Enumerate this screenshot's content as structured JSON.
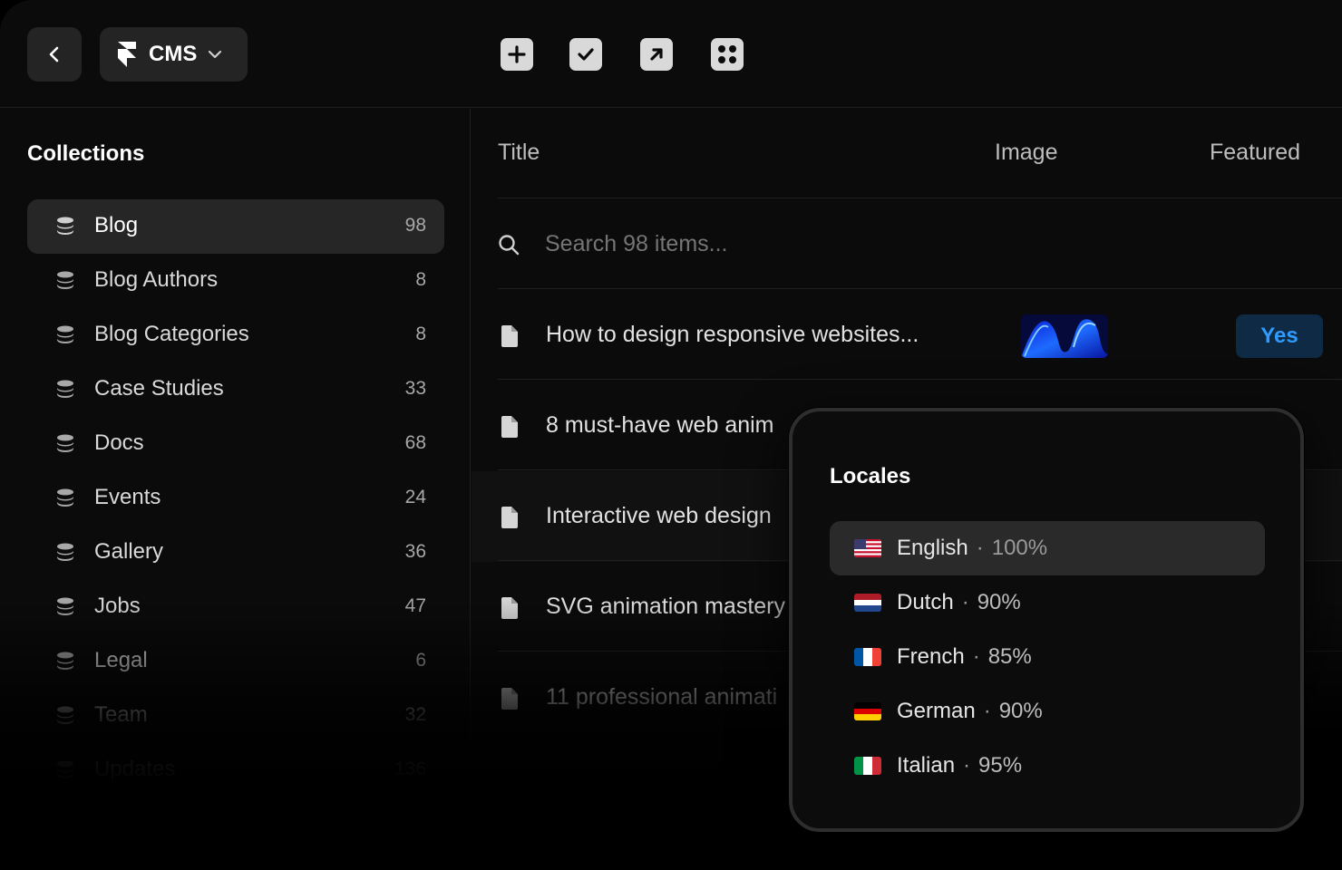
{
  "toolbar": {
    "cms_label": "CMS"
  },
  "sidebar": {
    "title": "Collections",
    "items": [
      {
        "label": "Blog",
        "count": "98",
        "active": true
      },
      {
        "label": "Blog Authors",
        "count": "8"
      },
      {
        "label": "Blog Categories",
        "count": "8"
      },
      {
        "label": "Case Studies",
        "count": "33"
      },
      {
        "label": "Docs",
        "count": "68"
      },
      {
        "label": "Events",
        "count": "24"
      },
      {
        "label": "Gallery",
        "count": "36"
      },
      {
        "label": "Jobs",
        "count": "47"
      },
      {
        "label": "Legal",
        "count": "6"
      },
      {
        "label": "Team",
        "count": "32"
      },
      {
        "label": "Updates",
        "count": "136"
      }
    ]
  },
  "table": {
    "columns": {
      "title": "Title",
      "image": "Image",
      "featured": "Featured"
    },
    "search_placeholder": "Search 98 items...",
    "rows": [
      {
        "title": "How to design responsive websites...",
        "featured": "Yes"
      },
      {
        "title": "8 must-have web anim"
      },
      {
        "title": "Interactive web design"
      },
      {
        "title": "SVG animation mastery"
      },
      {
        "title": "11 professional animati"
      }
    ]
  },
  "locales": {
    "title": "Locales",
    "items": [
      {
        "name": "English",
        "pct": "100%",
        "active": true,
        "flag": "us"
      },
      {
        "name": "Dutch",
        "pct": "90%",
        "flag": "nl"
      },
      {
        "name": "French",
        "pct": "85%",
        "flag": "fr"
      },
      {
        "name": "German",
        "pct": "90%",
        "flag": "de"
      },
      {
        "name": "Italian",
        "pct": "95%",
        "flag": "it"
      }
    ],
    "separator": "·"
  },
  "colors": {
    "accent": "#2f9bff",
    "badge_bg": "#0f2a45"
  }
}
